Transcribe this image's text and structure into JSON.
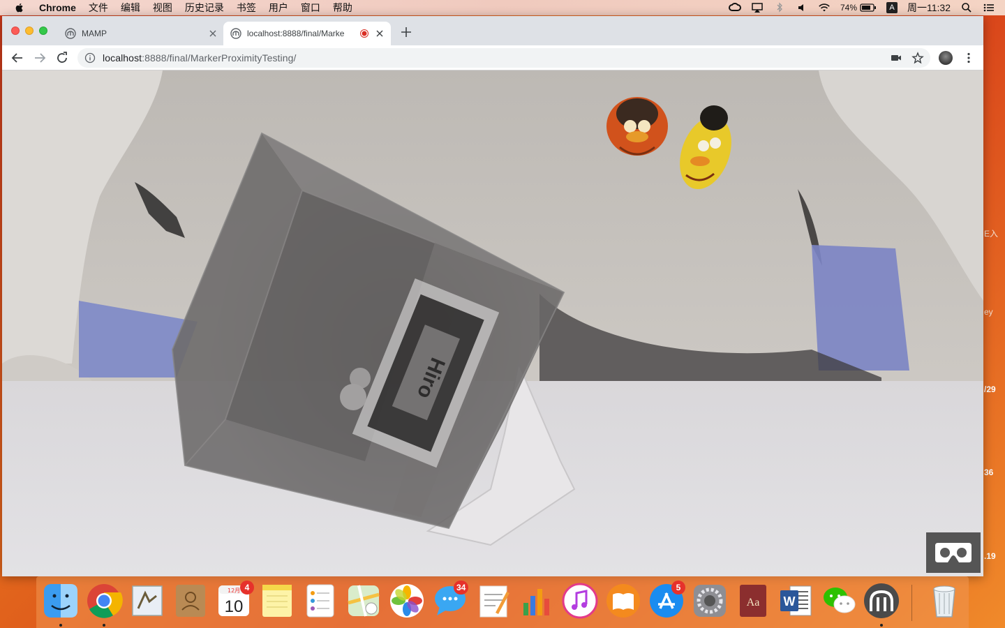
{
  "menubar": {
    "app_name": "Chrome",
    "items": [
      "文件",
      "编辑",
      "视图",
      "历史记录",
      "书签",
      "用户",
      "窗口",
      "帮助"
    ],
    "battery_percent": "74%",
    "input_method": "A",
    "clock": "周一11:32"
  },
  "browser": {
    "tabs": [
      {
        "title": "MAMP",
        "active": false
      },
      {
        "title": "localhost:8888/final/Marke",
        "active": true,
        "recording": true
      }
    ],
    "url_host": "localhost",
    "url_rest": ":8888/final/MarkerProximityTesting/"
  },
  "scene": {
    "marker_text": "Hiro"
  },
  "desktop_edge": {
    "labels": [
      "E入",
      "ey",
      "/29",
      "36",
      ".19"
    ]
  },
  "dock": {
    "items": [
      {
        "name": "finder",
        "badge": ""
      },
      {
        "name": "chrome",
        "badge": ""
      },
      {
        "name": "mail",
        "badge": ""
      },
      {
        "name": "contacts",
        "badge": ""
      },
      {
        "name": "calendar",
        "badge": "4",
        "month": "12月",
        "day": "10"
      },
      {
        "name": "notes",
        "badge": ""
      },
      {
        "name": "reminders",
        "badge": ""
      },
      {
        "name": "maps",
        "badge": ""
      },
      {
        "name": "photos",
        "badge": ""
      },
      {
        "name": "messages",
        "badge": "34"
      },
      {
        "name": "pages",
        "badge": ""
      },
      {
        "name": "numbers",
        "badge": ""
      },
      {
        "name": "itunes",
        "badge": ""
      },
      {
        "name": "ibooks",
        "badge": ""
      },
      {
        "name": "app-store",
        "badge": "5"
      },
      {
        "name": "system-preferences",
        "badge": ""
      },
      {
        "name": "dictionary",
        "badge": ""
      },
      {
        "name": "word",
        "badge": ""
      },
      {
        "name": "wechat",
        "badge": ""
      },
      {
        "name": "mamp",
        "badge": ""
      },
      {
        "name": "trash",
        "badge": ""
      }
    ]
  }
}
